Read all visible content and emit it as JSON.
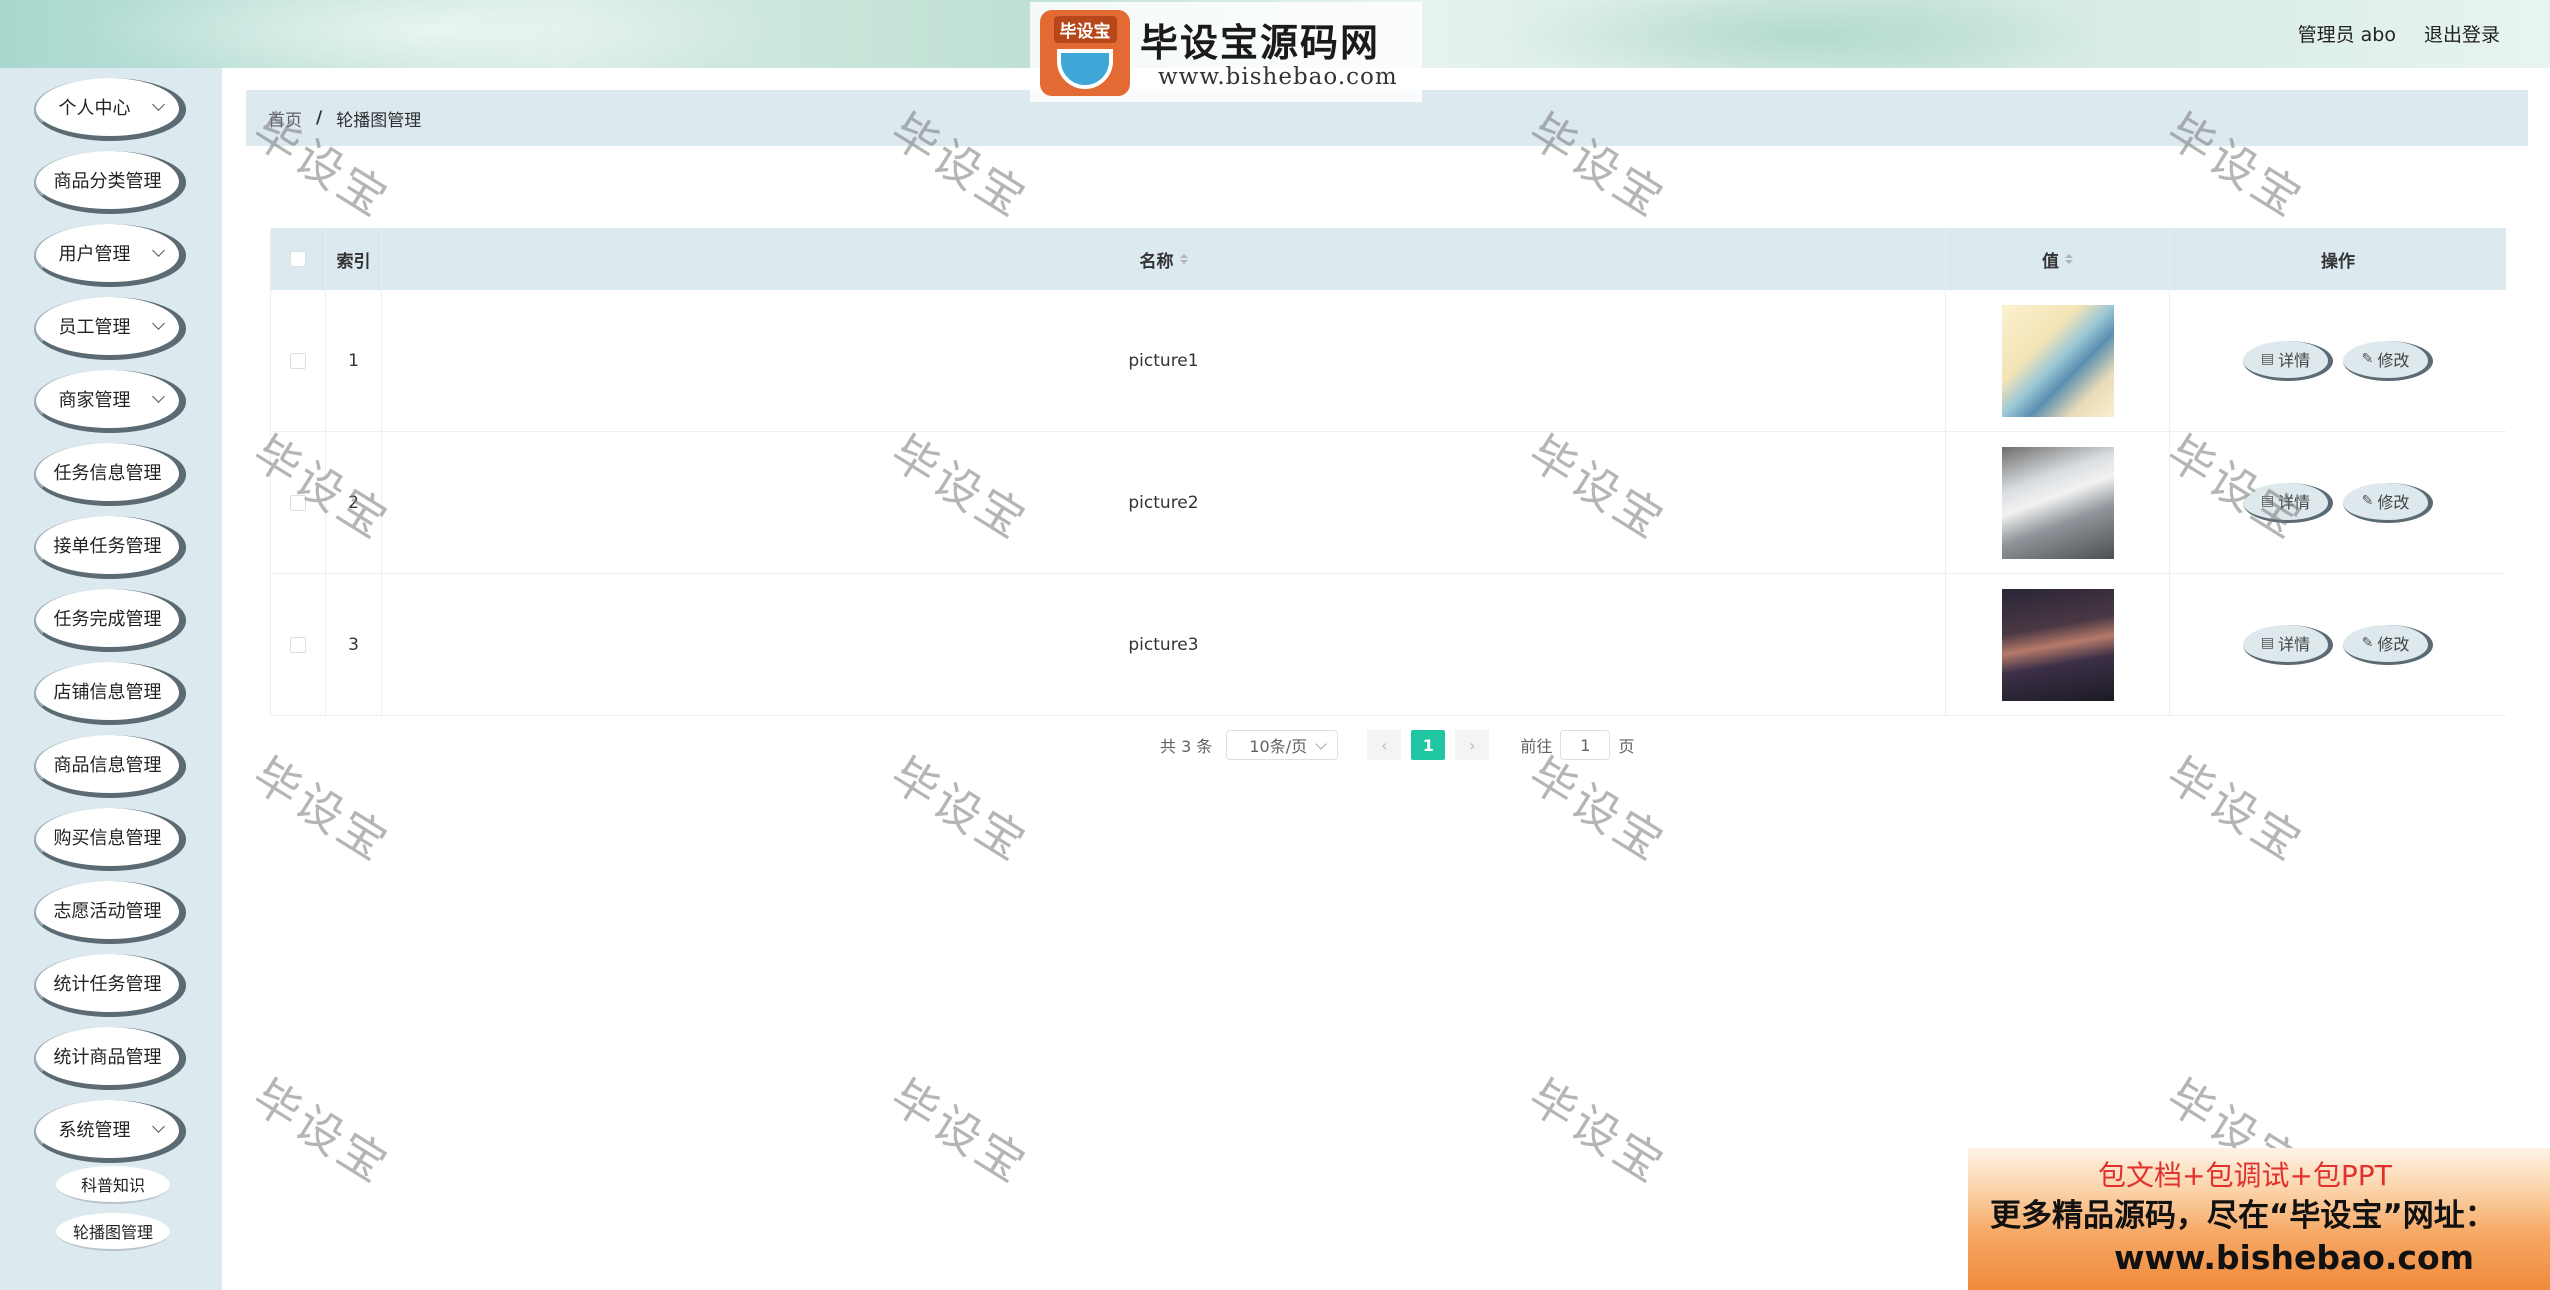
{
  "header": {
    "user_label": "管理员 abo",
    "logout_label": "退出登录",
    "logo_badge": "毕设宝",
    "logo_title": "毕设宝源码网",
    "logo_url": "www.bishebao.com"
  },
  "sidebar": {
    "items": [
      {
        "label": "个人中心",
        "chevron": true
      },
      {
        "label": "商品分类管理",
        "chevron": false
      },
      {
        "label": "用户管理",
        "chevron": true
      },
      {
        "label": "员工管理",
        "chevron": true
      },
      {
        "label": "商家管理",
        "chevron": true
      },
      {
        "label": "任务信息管理",
        "chevron": false
      },
      {
        "label": "接单任务管理",
        "chevron": false
      },
      {
        "label": "任务完成管理",
        "chevron": false
      },
      {
        "label": "店铺信息管理",
        "chevron": false
      },
      {
        "label": "商品信息管理",
        "chevron": false
      },
      {
        "label": "购买信息管理",
        "chevron": false
      },
      {
        "label": "志愿活动管理",
        "chevron": false
      },
      {
        "label": "统计任务管理",
        "chevron": false
      },
      {
        "label": "统计商品管理",
        "chevron": false
      },
      {
        "label": "系统管理",
        "chevron": true
      }
    ],
    "sub_items": [
      {
        "label": "科普知识"
      },
      {
        "label": "轮播图管理"
      }
    ]
  },
  "breadcrumb": {
    "home": "首页",
    "separator": "/",
    "current": "轮播图管理"
  },
  "table": {
    "columns": {
      "index": "索引",
      "name": "名称",
      "value": "值",
      "ops": "操作"
    },
    "rows": [
      {
        "index": "1",
        "name": "picture1",
        "image": "thumb1"
      },
      {
        "index": "2",
        "name": "picture2",
        "image": "thumb2"
      },
      {
        "index": "3",
        "name": "picture3",
        "image": "thumb3"
      }
    ],
    "detail_label": "详情",
    "edit_label": "修改"
  },
  "pagination": {
    "total": "共 3 条",
    "page_size": "10条/页",
    "current_page": "1",
    "goto_prefix": "前往",
    "goto_value": "1",
    "goto_suffix": "页"
  },
  "watermark": "毕设宝",
  "ad": {
    "line1": "包文档+包调试+包PPT",
    "line2": "更多精品源码，尽在“毕设宝”网址：",
    "line3": "www.bishebao.com"
  },
  "colors": {
    "accent": "#20c6a1",
    "sidebar_bg": "#dce9ee",
    "header_bg": "#bfe1d3"
  }
}
